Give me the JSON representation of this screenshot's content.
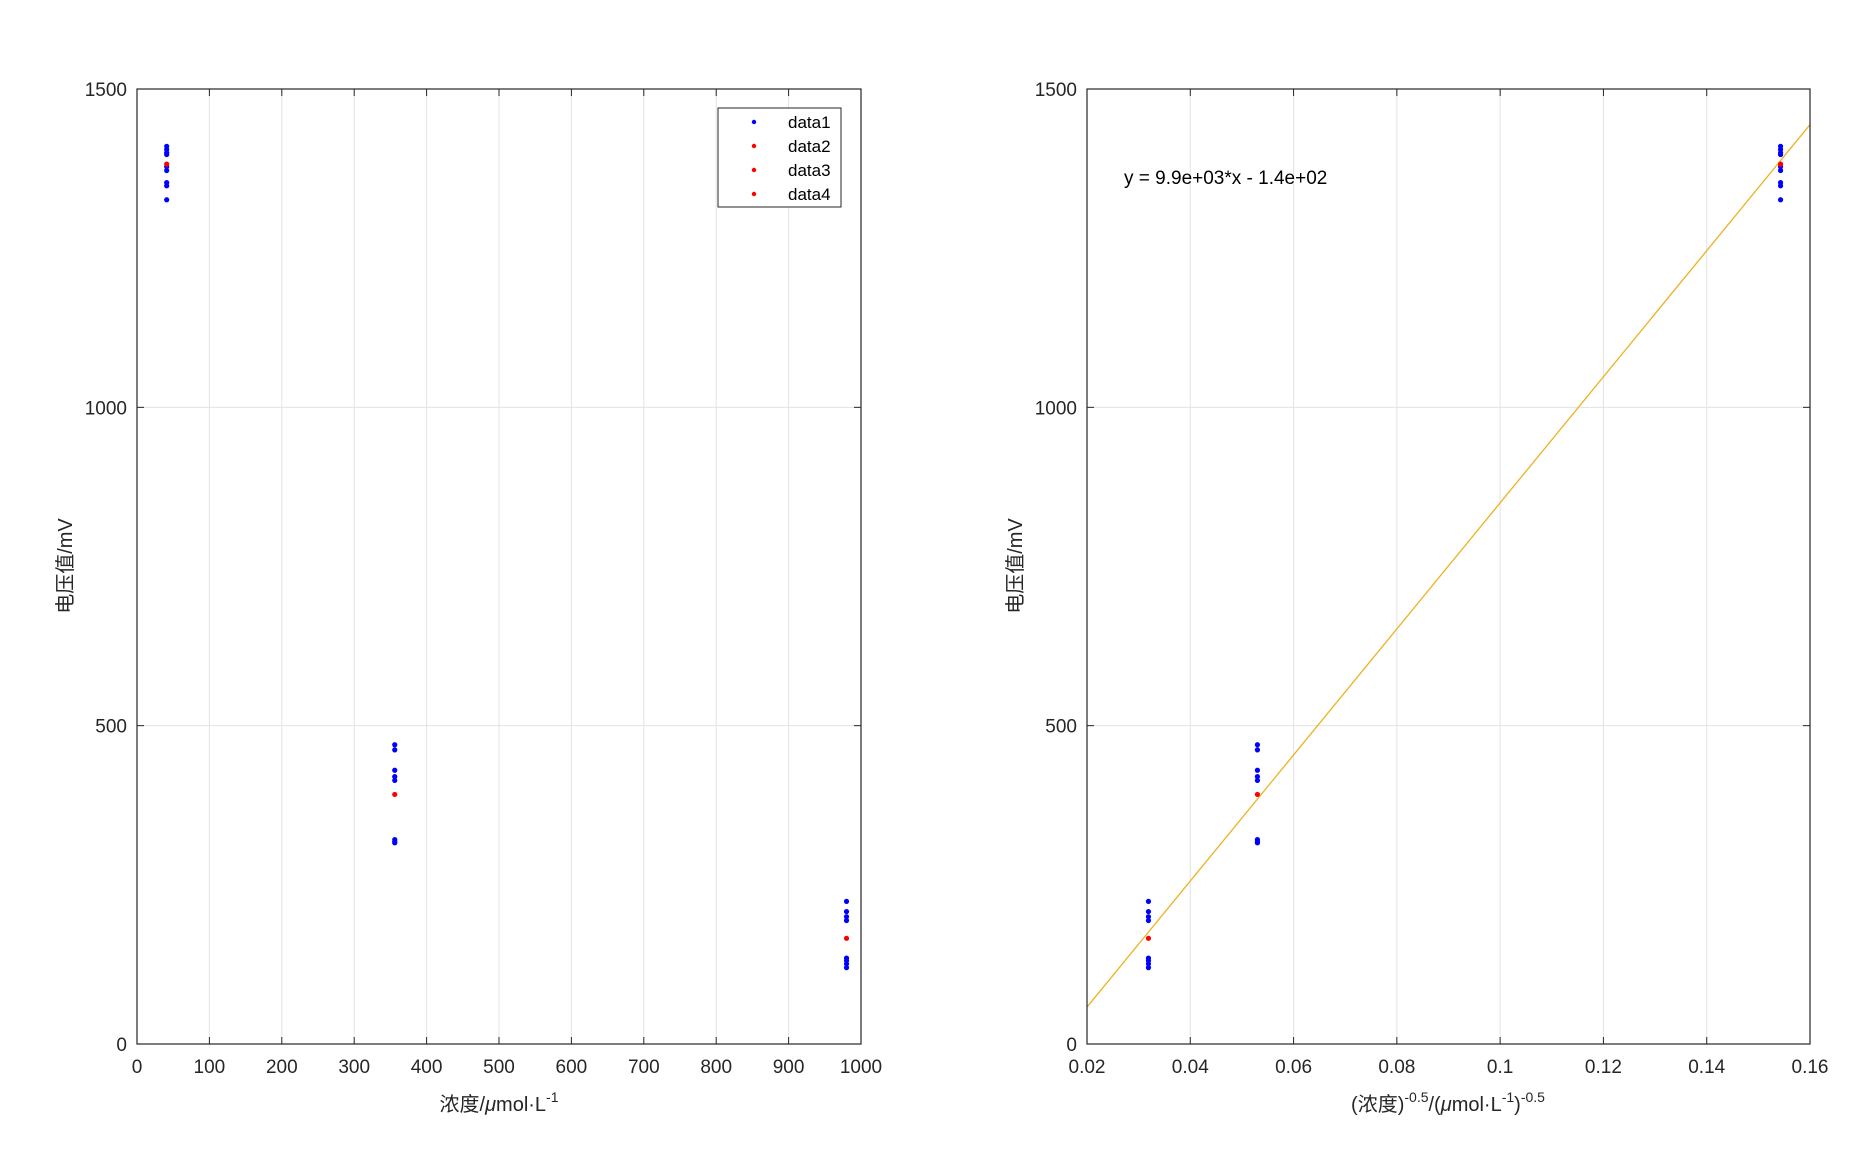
{
  "chart_data": [
    {
      "type": "scatter",
      "xlabel": "浓度/μmol·L⁻¹",
      "xlabel_parts": {
        "base": "浓度/",
        "mu": "μ",
        "unit": "mol·L",
        "sup": "-1"
      },
      "ylabel": "电压值/mV",
      "xlim": [
        0,
        1000
      ],
      "ylim": [
        0,
        1500
      ],
      "xticks": [
        0,
        100,
        200,
        300,
        400,
        500,
        600,
        700,
        800,
        900,
        1000
      ],
      "yticks": [
        0,
        500,
        1000,
        1500
      ],
      "grid": true,
      "legend_position": "top-right",
      "series": [
        {
          "name": "data1",
          "color": "#0000ff",
          "points": [
            [
              41,
              1410
            ],
            [
              41,
              1405
            ],
            [
              41,
              1400
            ],
            [
              41,
              1397
            ],
            [
              41,
              1378
            ],
            [
              41,
              1372
            ],
            [
              41,
              1353
            ],
            [
              41,
              1348
            ],
            [
              41,
              1326
            ],
            [
              356,
              470
            ],
            [
              356,
              462
            ],
            [
              356,
              430
            ],
            [
              356,
              420
            ],
            [
              356,
              414
            ],
            [
              356,
              321
            ],
            [
              356,
              318
            ],
            [
              356,
              316
            ],
            [
              980,
              224
            ],
            [
              980,
              208
            ],
            [
              980,
              200
            ],
            [
              980,
              194
            ],
            [
              980,
              135
            ],
            [
              980,
              131
            ],
            [
              980,
              126
            ],
            [
              980,
              120
            ]
          ]
        },
        {
          "name": "data2",
          "color": "#ff0000",
          "points": [
            [
              41,
              1382
            ]
          ]
        },
        {
          "name": "data3",
          "color": "#ff0000",
          "points": [
            [
              356,
              392
            ]
          ]
        },
        {
          "name": "data4",
          "color": "#ff0000",
          "points": [
            [
              980,
              166
            ]
          ]
        }
      ]
    },
    {
      "type": "scatter",
      "xlabel": "(浓度)^-0.5/(μmol·L^-1)^-0.5",
      "xlabel_parts": {
        "p1": "(浓度)",
        "sup1": "-0.5",
        "p2": "/(",
        "mu": "μ",
        "p3": "mol·L",
        "sup2": "-1",
        "p4": ")",
        "sup3": "-0.5"
      },
      "ylabel": "电压值/mV",
      "xlim": [
        0.02,
        0.16
      ],
      "ylim": [
        0,
        1500
      ],
      "xticks": [
        0.02,
        0.04,
        0.06,
        0.08,
        0.1,
        0.12,
        0.14,
        0.16
      ],
      "xtick_labels": [
        "0.02",
        "0.04",
        "0.06",
        "0.08",
        "0.1",
        "0.12",
        "0.14",
        "0.16"
      ],
      "yticks": [
        0,
        500,
        1000,
        1500
      ],
      "grid": true,
      "annotation": "y = 9.9e+03*x - 1.4e+02",
      "fit_line": {
        "slope": 9900,
        "intercept": -140,
        "color": "#edb120"
      },
      "series": [
        {
          "name": "data1",
          "color": "#0000ff",
          "points": [
            [
              0.1543,
              1410
            ],
            [
              0.1543,
              1405
            ],
            [
              0.1543,
              1400
            ],
            [
              0.1543,
              1397
            ],
            [
              0.1543,
              1378
            ],
            [
              0.1543,
              1372
            ],
            [
              0.1543,
              1353
            ],
            [
              0.1543,
              1348
            ],
            [
              0.1543,
              1326
            ],
            [
              0.053,
              470
            ],
            [
              0.053,
              462
            ],
            [
              0.053,
              430
            ],
            [
              0.053,
              420
            ],
            [
              0.053,
              414
            ],
            [
              0.053,
              321
            ],
            [
              0.053,
              318
            ],
            [
              0.053,
              316
            ],
            [
              0.0319,
              224
            ],
            [
              0.0319,
              208
            ],
            [
              0.0319,
              200
            ],
            [
              0.0319,
              194
            ],
            [
              0.0319,
              135
            ],
            [
              0.0319,
              131
            ],
            [
              0.0319,
              126
            ],
            [
              0.0319,
              120
            ]
          ]
        },
        {
          "name": "data2",
          "color": "#ff0000",
          "points": [
            [
              0.1543,
              1382
            ]
          ]
        },
        {
          "name": "data3",
          "color": "#ff0000",
          "points": [
            [
              0.053,
              392
            ]
          ]
        },
        {
          "name": "data4",
          "color": "#ff0000",
          "points": [
            [
              0.0319,
              166
            ]
          ]
        }
      ]
    }
  ]
}
